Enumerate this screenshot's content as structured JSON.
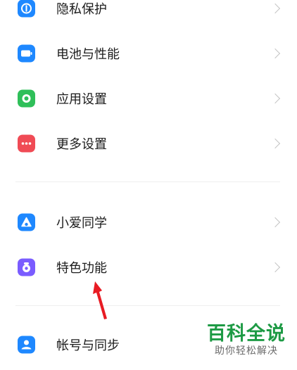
{
  "settings_list": {
    "items": [
      {
        "label": "隐私保护",
        "icon": "privacy-icon",
        "color": "#1e88ff"
      },
      {
        "label": "电池与性能",
        "icon": "battery-icon",
        "color": "#1e88ff"
      },
      {
        "label": "应用设置",
        "icon": "app-settings-icon",
        "color": "#2fbf59"
      },
      {
        "label": "更多设置",
        "icon": "more-settings-icon",
        "color": "#f04b55"
      },
      {
        "label": "小爱同学",
        "icon": "xiaoai-icon",
        "color": "#1e88ff"
      },
      {
        "label": "特色功能",
        "icon": "special-features-icon",
        "color": "#7a5cff"
      },
      {
        "label": "帐号与同步",
        "icon": "account-icon",
        "color": "#1e88ff"
      }
    ]
  },
  "annotation": {
    "arrow_color": "#e81b23"
  },
  "watermark": {
    "title": "百科全说",
    "subtitle": "助你轻松解决",
    "title_color": "#1d9a44",
    "subtitle_color": "#6a6a6a"
  }
}
